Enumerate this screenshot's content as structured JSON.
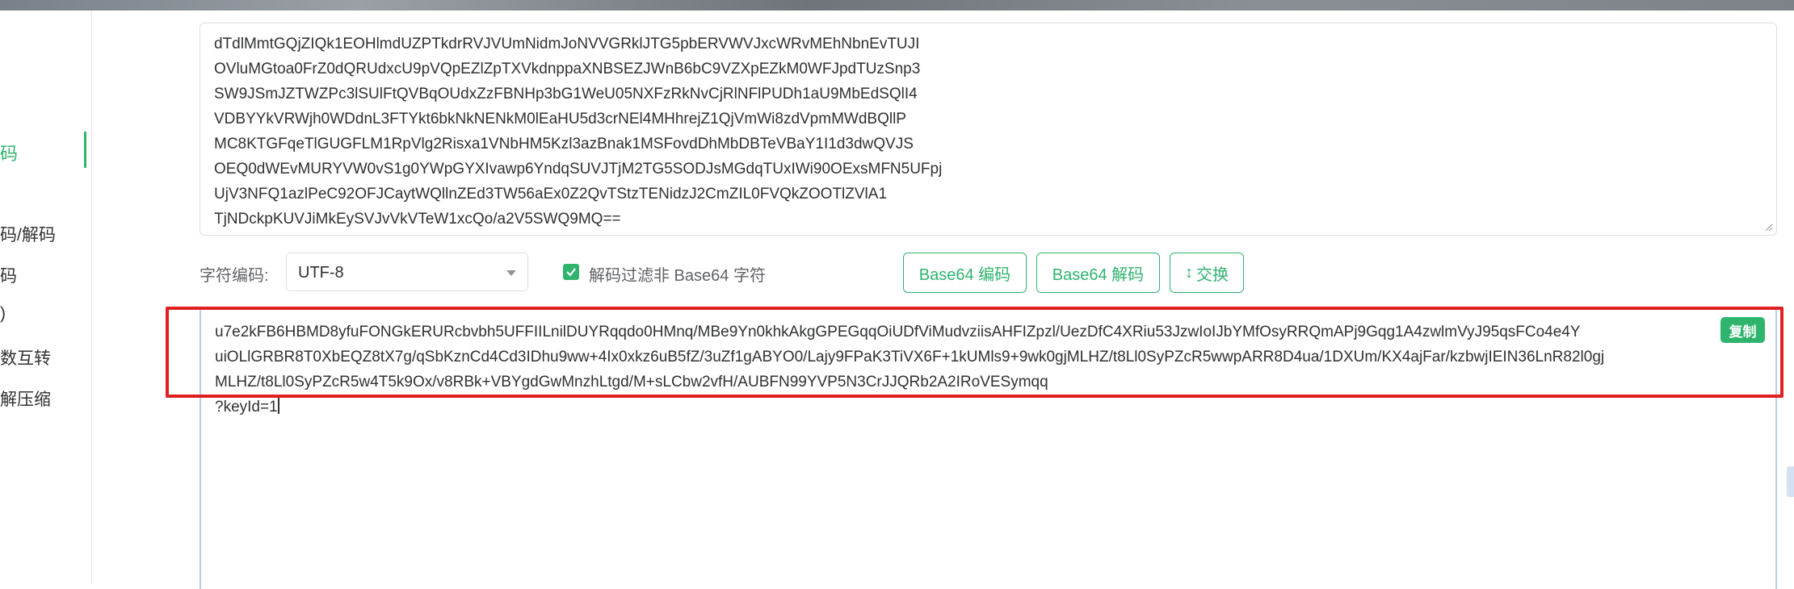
{
  "sidebar": {
    "active_item": "码",
    "items": [
      "码/解码",
      "码",
      ")",
      "数互转",
      "解压缩"
    ]
  },
  "input": {
    "lines": [
      "dTdlMmtGQjZIQk1EOHlmdUZPTkdrRVJVUmNidmJoNVVGRklJTG5pbERVWVJxcWRvMEhNbnEvTUJI",
      "OVluMGtoa0FrZ0dQRUdxcU9pVQpEZlZpTXVkdnppaXNBSEZJWnB6bC9VZXpEZkM0WFJpdTUzSnp3",
      "SW9JSmJZTWZPc3lSUlFtQVBqOUdxZzFBNHp3bG1WeU05NXFzRkNvCjRlNFlPUDh1aU9MbEdSQlI4",
      "VDBYYkVRWjh0WDdnL3FTYkt6bkNkNENkM0lEaHU5d3crNEl4MHhrejZ1QjVmWi8zdVpmMWdBQllP",
      "MC8KTGFqeTlGUGFLM1RpVlg2Risxa1VNbHM5Kzl3azBnak1MSFovdDhMbDBTeVBaY1I1d3dwQVJS",
      "OEQ0dWEvMURYVW0vS1g0YWpGYXIvawp6YndqSUVJTjM2TG5SODJsMGdqTUxIWi90OExsMFN5UFpj",
      "UjV3NFQ1azlPeC92OFJCaytWQllnZEd3TW56aEx0Z2QvTStzTENidzJ2CmZIL0FVQkZOOTlZVlA1",
      "TjNDckpKUVJiMkEySVJvVkVTeW1xcQo/a2V5SWQ9MQ=="
    ]
  },
  "controls": {
    "encoding_label": "字符编码:",
    "encoding_value": "UTF-8",
    "filter_checked": true,
    "filter_label": "解码过滤非 Base64 字符",
    "encode_button": "Base64 编码",
    "decode_button": "Base64 解码",
    "swap_button": "交换",
    "swap_icon": "↕"
  },
  "output": {
    "lines": [
      "u7e2kFB6HBMD8yfuFONGkERURcbvbh5UFFIILnilDUYRqqdo0HMnq/MBe9Yn0khkAkgGPEGqqOiUDfViMudvziisAHFIZpzl/UezDfC4XRiu53JzwIoIJbYMfOsyRRQmAPj9Gqg1A4zwlmVyJ95qsFCo4e4Y",
      "uiOLlGRBR8T0XbEQZ8tX7g/qSbKznCd4Cd3IDhu9ww+4Ix0xkz6uB5fZ/3uZf1gABYO0/Lajy9FPaK3TiVX6F+1kUMls9+9wk0gjMLHZ/t8Ll0SyPZcR5wwpARR8D4ua/1DXUm/KX4ajFar/kzbwjIEIN36LnR82l0gj",
      "MLHZ/t8Ll0SyPZcR5w4T5k9Ox/v8RBk+VBYgdGwMnzhLtgd/M+sLCbw2vfH/AUBFN99YVP5N3CrJJQRb2A2IRoVESymqq",
      "?keyId=1"
    ],
    "copy_label": "复制"
  },
  "colors": {
    "accent": "#2fb46e",
    "highlight": "#e02020",
    "text": "#303133"
  }
}
